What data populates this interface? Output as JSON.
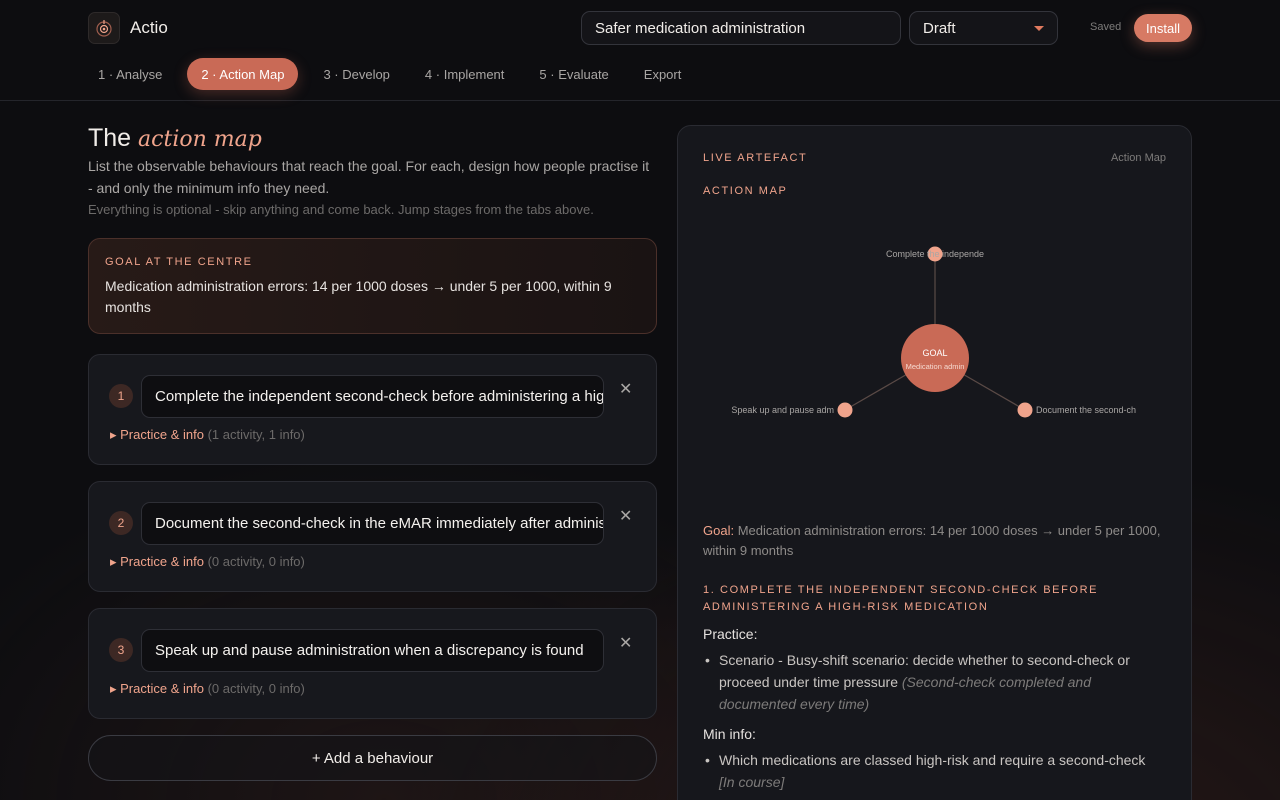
{
  "app": {
    "name": "Actio"
  },
  "header": {
    "project_title": "Safer medication administration",
    "status": "Draft",
    "saved": "Saved",
    "install": "Install"
  },
  "tabs": [
    {
      "label": "1 · Analyse"
    },
    {
      "label": "2 · Action Map",
      "active": true
    },
    {
      "label": "3 · Develop"
    },
    {
      "label": "4 · Implement"
    },
    {
      "label": "5 · Evaluate"
    },
    {
      "label": "Export"
    }
  ],
  "main": {
    "title_prefix": "The",
    "title_accent": "action map",
    "intro": "List the observable behaviours that reach the goal. For each, design how people practise it - and only the minimum info they need.",
    "hint": "Everything is optional - skip anything and come back. Jump stages from the tabs above.",
    "goal_label": "GOAL AT THE CENTRE",
    "goal_text": "Medication administration errors: 14 per 1000 doses → under 5 per 1000, within 9 months",
    "practice_link": "▸ Practice & info",
    "behaviours": [
      {
        "num": "1",
        "text": "Complete the independent second-check before administering a high-risk medication",
        "count": "(1 activity, 1 info)"
      },
      {
        "num": "2",
        "text": "Document the second-check in the eMAR immediately after administration",
        "count": "(0 activity, 0 info)"
      },
      {
        "num": "3",
        "text": "Speak up and pause administration when a discrepancy is found",
        "count": "(0 activity, 0 info)"
      }
    ],
    "add_button": "+ Add a behaviour"
  },
  "panel": {
    "label": "LIVE ARTEFACT",
    "type": "Action Map",
    "map_label": "ACTION MAP",
    "map": {
      "center_title": "GOAL",
      "center_sub": "Medication admin",
      "node_labels": [
        "Complete the independe",
        "Document the second-ch",
        "Speak up and pause adm"
      ]
    },
    "goal_prefix": "Goal:",
    "goal_text": "Medication administration errors: 14 per 1000 doses → under 5 per 1000, within 9 months",
    "section_title": "1. COMPLETE THE INDEPENDENT SECOND-CHECK BEFORE ADMINISTERING A HIGH-RISK MEDICATION",
    "practice_head": "Practice:",
    "practice_item": "Scenario - Busy-shift scenario: decide whether to second-check or proceed under time pressure",
    "practice_note": "(Second-check completed and documented every time)",
    "min_head": "Min info:",
    "min_item": "Which medications are classed high-risk and require a second-check",
    "min_note": "[In course]"
  },
  "colors": {
    "accent": "#d77a64",
    "accent_light": "#f0a48c",
    "bg": "#0d0d10",
    "panel": "#16171c"
  },
  "icons": {
    "logo": "target-logo-icon",
    "close": "close-icon",
    "dropdown": "chevron-down-icon"
  }
}
